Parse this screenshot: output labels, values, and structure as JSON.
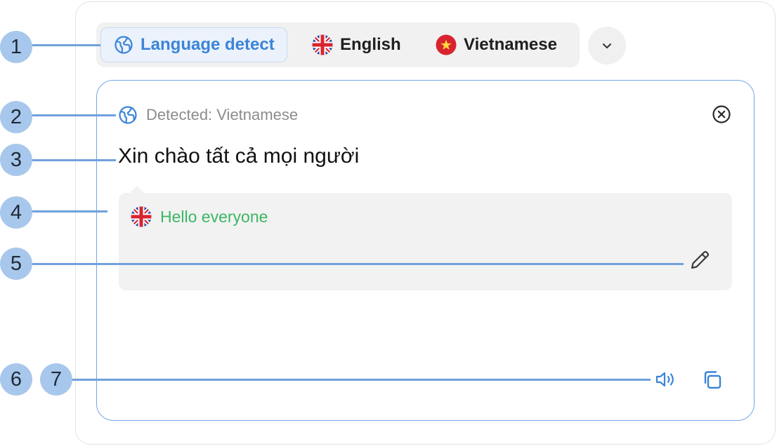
{
  "language_bar": {
    "chips": [
      {
        "label": "Language detect",
        "icon": "globe-icon",
        "active": true
      },
      {
        "label": "English",
        "icon": "uk-flag-icon",
        "active": false
      },
      {
        "label": "Vietnamese",
        "icon": "vietnam-flag-icon",
        "active": false
      }
    ],
    "more_icon": "chevron-down-icon"
  },
  "panel": {
    "detected_label": "Detected: Vietnamese",
    "close_icon": "close-circle-icon",
    "source_text": "Xin chào tất cả mọi người",
    "translation": {
      "flag_icon": "uk-flag-icon",
      "text": "Hello everyone",
      "edit_icon": "pencil-icon"
    },
    "actions": {
      "speaker_icon": "speaker-icon",
      "copy_icon": "copy-icon"
    }
  },
  "callouts": [
    "1",
    "2",
    "3",
    "4",
    "5",
    "6",
    "7"
  ],
  "colors": {
    "accent": "#3c84d8",
    "panel_border": "#72a6e2",
    "translation_text": "#3bb764",
    "callout_bg": "#a8c7ec",
    "leader_line": "#6fa1dd"
  }
}
